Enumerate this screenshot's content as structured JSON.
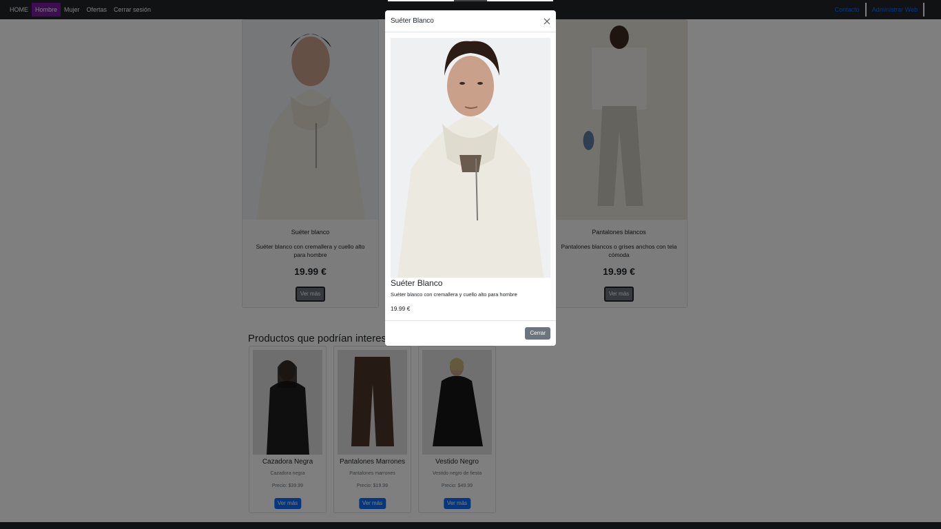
{
  "navbar": {
    "links": [
      "HOME",
      "Hombre",
      "Mujer",
      "Ofertas",
      "Cerrar sesión"
    ],
    "right_links": [
      "Contacto",
      "Administrar Web"
    ]
  },
  "products": [
    {
      "title": "Suéter blanco",
      "description": "Suéter blanco con cremallera y cuello alto para hombre",
      "price": "19.99 €",
      "button": "Ver más"
    },
    {
      "title": "Pantalones blancos",
      "description": "Pantalones blancos o grises anchos con tela cómoda",
      "price": "19.99 €",
      "button": "Ver más"
    }
  ],
  "recommendations": {
    "heading": "Productos que podrían interesa",
    "items": [
      {
        "title": "Cazadora Negra",
        "description": "Cazadora negra",
        "price": "Precio: $39.99",
        "button": "Ver más"
      },
      {
        "title": "Pantalones Marrones",
        "description": "Pantalones marrones",
        "price": "Precio: $19.99",
        "button": "Ver más"
      },
      {
        "title": "Vestido Negro",
        "description": "Vestido negro de fiesta",
        "price": "Precio: $49.99",
        "button": "Ver más"
      }
    ]
  },
  "modal": {
    "title": "Suéter Blanco",
    "product_title": "Suéter Blanco",
    "description": "Suéter blanco con cremallera y cuello alto para hombre",
    "price": "19.99 €",
    "close_button": "Cerrar"
  },
  "colors": {
    "navbar_bg": "#212529",
    "active_nav": "#7a1fa2",
    "link_blue": "#0d6efd",
    "button_secondary": "#6c757d"
  }
}
